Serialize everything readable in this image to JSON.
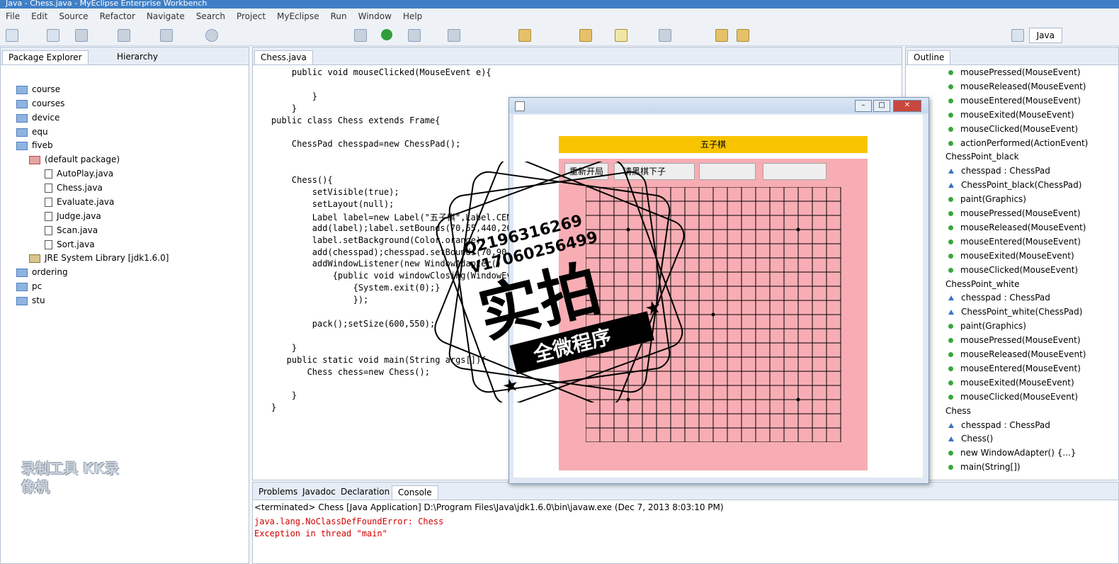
{
  "window_title": "Java - Chess.java - MyEclipse Enterprise Workbench",
  "menu": [
    "File",
    "Edit",
    "Source",
    "Refactor",
    "Navigate",
    "Search",
    "Project",
    "MyEclipse",
    "Run",
    "Window",
    "Help"
  ],
  "perspective": "Java",
  "package_explorer": {
    "tabs": [
      "Package Explorer",
      "Hierarchy"
    ],
    "items": [
      "course",
      "courses",
      "device",
      "equ",
      "fiveb",
      "(default package)",
      "AutoPlay.java",
      "Chess.java",
      "Evaluate.java",
      "Judge.java",
      "Scan.java",
      "Sort.java",
      "JRE System Library [jdk1.6.0]",
      "ordering",
      "pc",
      "stu"
    ]
  },
  "editor": {
    "tab": "Chess.java",
    "lines": [
      "    public void mouseClicked(MouseEvent e){",
      "",
      "        }",
      "    }",
      "public class Chess extends Frame{",
      "",
      "    ChessPad chesspad=new ChessPad();",
      "",
      "",
      "    Chess(){",
      "        setVisible(true);",
      "        setLayout(null);",
      "        Label label=new Label(\"五子棋\",Label.CENTER);",
      "        add(label);label.setBounds(70,55,440,26);",
      "        label.setBackground(Color.orange);",
      "        add(chesspad);chesspad.setBounds(70,90,440,440);",
      "        addWindowListener(new WindowAdapter()",
      "            {public void windowClosing(WindowEvent e)",
      "                {System.exit(0);}",
      "                });",
      "",
      "        pack();setSize(600,550);",
      "",
      "    }",
      "   public static void main(String args[]){",
      "       Chess chess=new Chess();",
      "",
      "    }",
      "}"
    ]
  },
  "app_window": {
    "label": "五子棋",
    "restart_button": "重新开局",
    "status_text": "请黑棋下子",
    "btn_min": "–",
    "btn_max": "□",
    "btn_close": "✕"
  },
  "outline": {
    "tab": "Outline",
    "items": [
      {
        "kind": "method",
        "text": "mousePressed(MouseEvent)"
      },
      {
        "kind": "method",
        "text": "mouseReleased(MouseEvent)"
      },
      {
        "kind": "method",
        "text": "mouseEntered(MouseEvent)"
      },
      {
        "kind": "method",
        "text": "mouseExited(MouseEvent)"
      },
      {
        "kind": "method",
        "text": "mouseClicked(MouseEvent)"
      },
      {
        "kind": "method",
        "text": "actionPerformed(ActionEvent)"
      },
      {
        "kind": "class",
        "text": "ChessPoint_black"
      },
      {
        "kind": "field",
        "text": "chesspad : ChessPad"
      },
      {
        "kind": "ctor",
        "text": "ChessPoint_black(ChessPad)"
      },
      {
        "kind": "method",
        "text": "paint(Graphics)"
      },
      {
        "kind": "method",
        "text": "mousePressed(MouseEvent)"
      },
      {
        "kind": "method",
        "text": "mouseReleased(MouseEvent)"
      },
      {
        "kind": "method",
        "text": "mouseEntered(MouseEvent)"
      },
      {
        "kind": "method",
        "text": "mouseExited(MouseEvent)"
      },
      {
        "kind": "method",
        "text": "mouseClicked(MouseEvent)"
      },
      {
        "kind": "class",
        "text": "ChessPoint_white"
      },
      {
        "kind": "field",
        "text": "chesspad : ChessPad"
      },
      {
        "kind": "ctor",
        "text": "ChessPoint_white(ChessPad)"
      },
      {
        "kind": "method",
        "text": "paint(Graphics)"
      },
      {
        "kind": "method",
        "text": "mousePressed(MouseEvent)"
      },
      {
        "kind": "method",
        "text": "mouseReleased(MouseEvent)"
      },
      {
        "kind": "method",
        "text": "mouseEntered(MouseEvent)"
      },
      {
        "kind": "method",
        "text": "mouseExited(MouseEvent)"
      },
      {
        "kind": "method",
        "text": "mouseClicked(MouseEvent)"
      },
      {
        "kind": "class",
        "text": "Chess"
      },
      {
        "kind": "field",
        "text": "chesspad : ChessPad"
      },
      {
        "kind": "ctor",
        "text": "Chess()"
      },
      {
        "kind": "inner",
        "text": "new WindowAdapter() {...}"
      },
      {
        "kind": "static",
        "text": "main(String[])"
      }
    ]
  },
  "console": {
    "tabs": [
      "Problems",
      "Javadoc",
      "Declaration",
      "Console"
    ],
    "header": "<terminated> Chess [Java Application] D:\\Program Files\\Java\\jdk1.6.0\\bin\\javaw.exe (Dec 7, 2013 8:03:10 PM)",
    "lines": [
      "java.lang.NoClassDefFoundError: Chess",
      "Exception in thread \"main\""
    ]
  },
  "watermark": {
    "qq": "Q2196316269",
    "wechat": "V17060256499",
    "big": "实拍",
    "banner": "全微程序",
    "recorder": "录制工具 KK录像机"
  }
}
